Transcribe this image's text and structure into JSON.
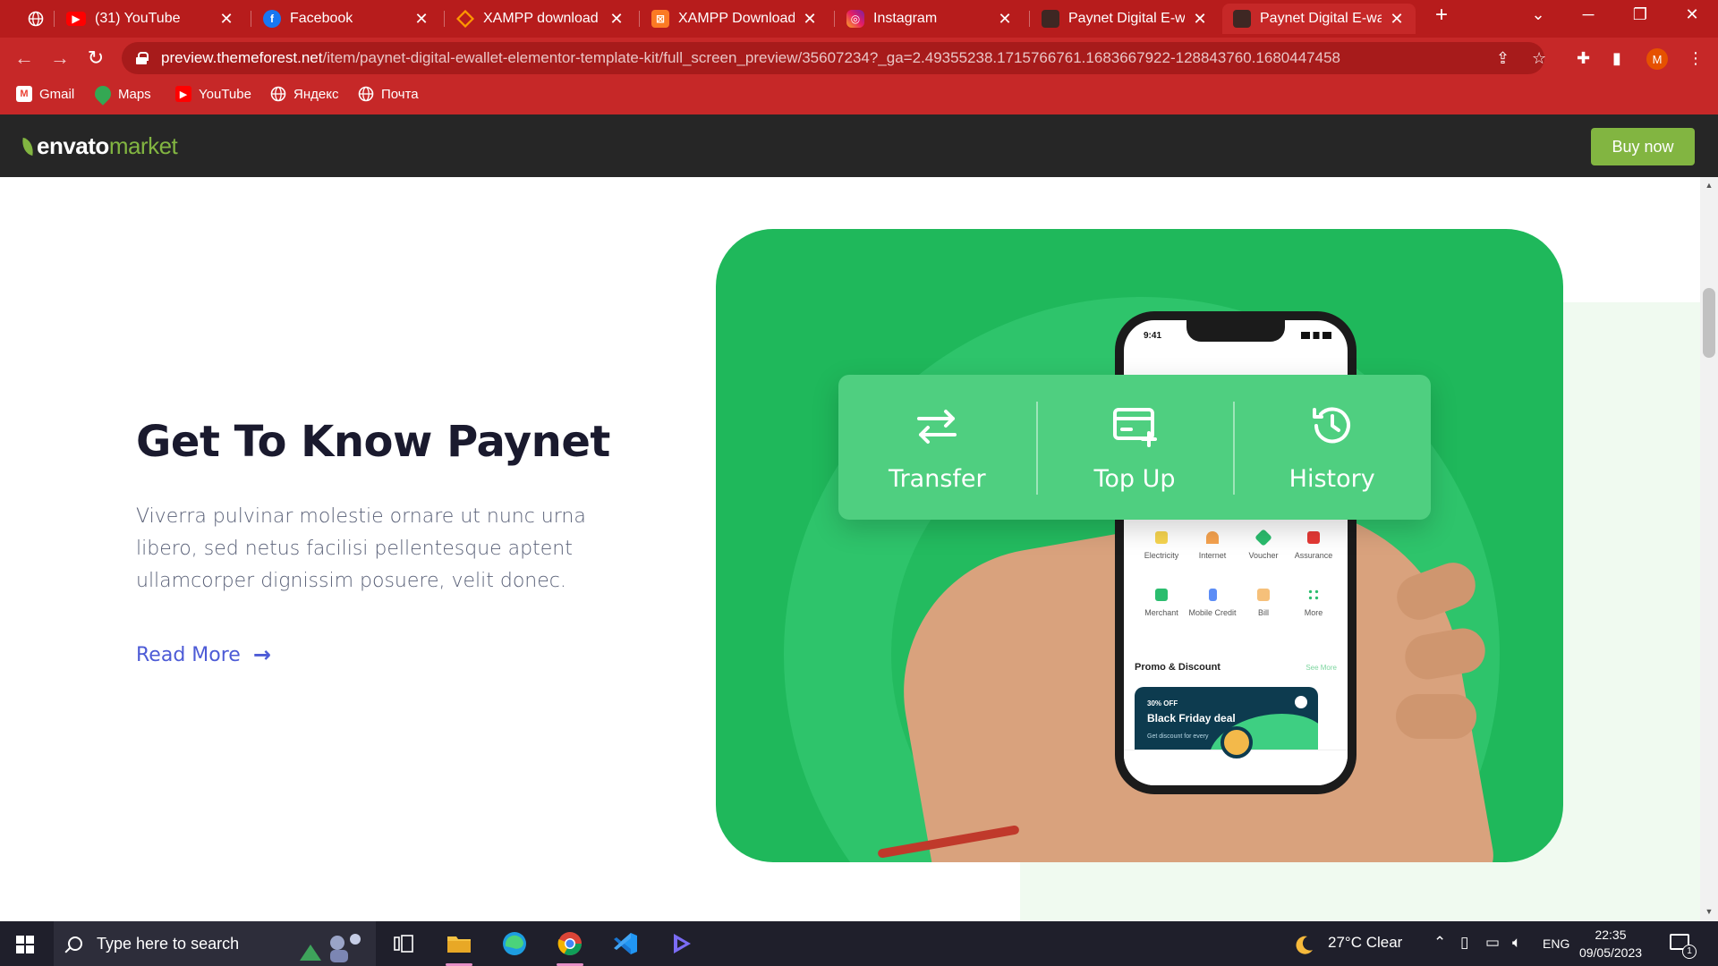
{
  "browser": {
    "tabs": [
      {
        "title": "",
        "icon": "globe-icon"
      },
      {
        "title": "(31) YouTube",
        "icon": "youtube-icon"
      },
      {
        "title": "Facebook",
        "icon": "facebook-icon"
      },
      {
        "title": "XAMPP download | S",
        "icon": "xampp-orange-icon"
      },
      {
        "title": "XAMPP Download Si",
        "icon": "xampp-icon"
      },
      {
        "title": "Instagram",
        "icon": "instagram-icon"
      },
      {
        "title": "Paynet Digital E-wall",
        "icon": "paynet-icon"
      },
      {
        "title": "Paynet Digital E-wall",
        "icon": "paynet-icon"
      }
    ],
    "new_tab": "+",
    "url_host": "preview.themeforest.net",
    "url_path": "/item/paynet-digital-ewallet-elementor-template-kit/full_screen_preview/35607234?_ga=2.49355238.1715766761.1683667922-128843760.1680447458",
    "profile_initial": "M",
    "bookmarks": [
      {
        "label": "Gmail",
        "icon": "gmail-icon"
      },
      {
        "label": "Maps",
        "icon": "maps-icon"
      },
      {
        "label": "YouTube",
        "icon": "youtube-icon"
      },
      {
        "label": "Яндекс",
        "icon": "globe-icon"
      },
      {
        "label": "Почта",
        "icon": "globe-icon"
      }
    ],
    "accent": "#c62828"
  },
  "envato": {
    "logo_envato": "envato",
    "logo_market": "market",
    "buy_now": "Buy now",
    "brand_green": "#82b541"
  },
  "page": {
    "heading": "Get To Know Paynet",
    "paragraph": "Viverra pulvinar molestie ornare ut nunc urna libero, sed netus facilisi pellentesque aptent ullamcorper dignissim posuere, velit donec.",
    "read_more": "Read More",
    "card_green": "#1fb85b",
    "actions": [
      {
        "label": "Transfer",
        "icon": "transfer-arrows-icon"
      },
      {
        "label": "Top Up",
        "icon": "card-plus-icon"
      },
      {
        "label": "History",
        "icon": "history-clock-icon"
      }
    ],
    "phone": {
      "time": "9:41",
      "services": [
        "Electricity",
        "Internet",
        "Voucher",
        "Assurance",
        "Merchant",
        "Mobile Credit",
        "Bill",
        "More"
      ],
      "promo_title": "Promo & Discount",
      "see_more": "See More",
      "promo_off": "30% OFF",
      "promo_deal": "Black Friday deal",
      "promo_desc": "Get discount for every"
    }
  },
  "taskbar": {
    "search_placeholder": "Type here to search",
    "weather": "27°C  Clear",
    "language": "ENG",
    "time": "22:35",
    "date": "09/05/2023",
    "notifications": "1"
  }
}
